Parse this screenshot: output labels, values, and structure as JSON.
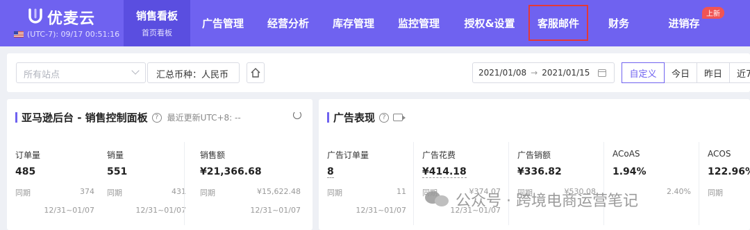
{
  "brand": {
    "name": "优麦云",
    "timezone": "(UTC-7): 09/17 00:51:16"
  },
  "nav": {
    "items": [
      {
        "label": "销售看板",
        "sub": "首页看板"
      },
      {
        "label": "广告管理"
      },
      {
        "label": "经营分析"
      },
      {
        "label": "库存管理"
      },
      {
        "label": "监控管理"
      },
      {
        "label": "授权&设置"
      },
      {
        "label": "客服邮件"
      },
      {
        "label": "财务"
      },
      {
        "label": "进销存"
      }
    ],
    "new_badge": "上新"
  },
  "filters": {
    "site_placeholder": "所有站点",
    "currency": "汇总币种：人民币",
    "date_start": "2021/01/08",
    "date_arrow": "→",
    "date_end": "2021/01/15",
    "segments": [
      "自定义",
      "今日",
      "昨日",
      "近7"
    ]
  },
  "sales_panel": {
    "title": "亚马逊后台 - 销售控制面板",
    "help": "?",
    "updated": "最近更新UTC+8: --",
    "metrics": [
      {
        "label": "订单量",
        "value": "485",
        "cmp_label": "同期",
        "cmp_value": "374",
        "range": "12/31~01/07"
      },
      {
        "label": "销量",
        "value": "551",
        "cmp_label": "同期",
        "cmp_value": "431",
        "range": "12/31~01/07"
      },
      {
        "label": "销售额",
        "value": "¥21,366.68",
        "cmp_label": "同期",
        "cmp_value": "¥15,622.48",
        "range": "12/31~01/07"
      }
    ]
  },
  "ads_panel": {
    "title": "广告表现",
    "help": "?",
    "metrics": [
      {
        "label": "广告订单量",
        "value": "8",
        "cmp_label": "同期",
        "cmp_value": "11",
        "range": "12/31~01/07"
      },
      {
        "label": "广告花费",
        "value": "¥414.18",
        "cmp_label": "同期",
        "cmp_value": "¥374.07",
        "range": "12/31~01/07"
      },
      {
        "label": "广告销额",
        "value": "¥336.82",
        "cmp_label": "同期",
        "cmp_value": "¥530.08",
        "range": ""
      },
      {
        "label": "ACoAS",
        "value": "1.94%",
        "cmp_label": "",
        "cmp_value": "2.40%",
        "range": ""
      },
      {
        "label": "ACOS",
        "value": "122.96%",
        "cmp_label": "同期",
        "cmp_value": "",
        "range": ""
      }
    ]
  },
  "watermark": "公众号 · 跨境电商运营笔记",
  "colors": {
    "accent": "#6f62f0",
    "nav_active": "#5a4ee0",
    "highlight_box": "#e53935"
  }
}
